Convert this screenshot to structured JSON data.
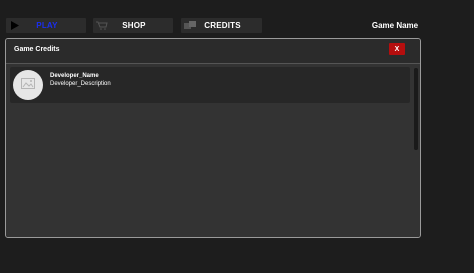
{
  "menu": {
    "play_label": "PLAY",
    "shop_label": "SHOP",
    "credits_label": "CREDITS",
    "play_icon": "play-icon",
    "shop_icon": "cart-icon",
    "credits_icon": "credits-icon"
  },
  "game_name": "Game Name",
  "panel": {
    "title": "Game Credits",
    "close_label": "X",
    "entries": [
      {
        "name": "Developer_Name",
        "description": "Developer_Description",
        "avatar_icon": "image-placeholder-icon"
      }
    ]
  },
  "colors": {
    "play_text": "#1a2ef0",
    "close_button": "#b50e0e",
    "background": "#1d1d1d"
  }
}
